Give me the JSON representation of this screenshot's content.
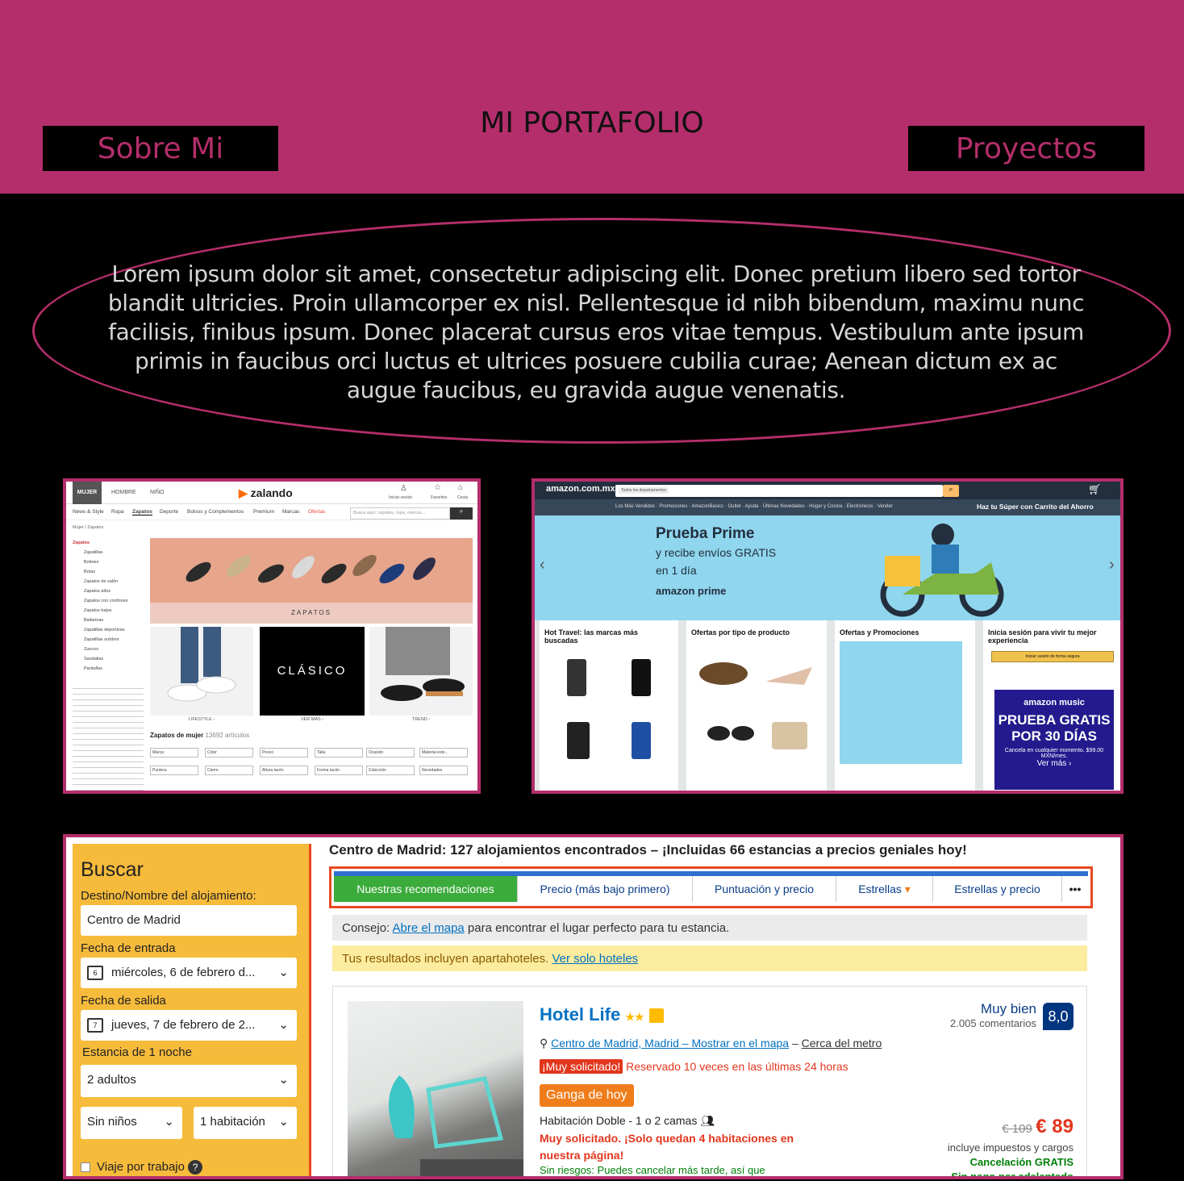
{
  "header": {
    "title": "MI PORTAFOLIO",
    "nav_left": "Sobre Mi",
    "nav_right": "Proyectos"
  },
  "intro": "Lorem ipsum dolor sit amet, consectetur adipiscing elit. Donec pretium libero sed tortor blandit ultricies. Proin ullamcorper ex nisl. Pellentesque id nibh bibendum, maximu nunc facilisis, finibus ipsum. Donec placerat cursus eros vitae tempus. Vestibulum ante ipsum primis in faucibus orci luctus et ultrices posuere cubilia curae; Aenean dictum ex ac augue faucibus, eu gravida augue venenatis.",
  "colors": {
    "accent": "#b42e6b",
    "background": "#000000",
    "booking_yellow": "#f7bb3b",
    "booking_orange": "#e8491f"
  },
  "zalando": {
    "tabs": [
      "MUJER",
      "HOMBRE",
      "NIÑO"
    ],
    "logo": "zalando",
    "account": [
      "Iniciar sesión",
      "Favoritos",
      "Cesta"
    ],
    "cats": [
      "News & Style",
      "Ropa",
      "Zapatos",
      "Deporte",
      "Bolsos y Complementos",
      "Premium",
      "Marcas",
      "Ofertas"
    ],
    "search": "Busca aquí: zapatos, ropa, marcas...",
    "crumb": "Mujer / Zapatos",
    "side": [
      "Zapatos",
      "Zapatillas",
      "Botines",
      "Botas",
      "Zapatos de salón",
      "Zapatos altos",
      "Zapatos con cordones",
      "Zapatos bajos",
      "Bailarinas",
      "Zapatillas deportivas",
      "Zapatillas outdoor",
      "Zuecos",
      "Sandalias",
      "Pantuflas"
    ],
    "banner": "ZAPATOS",
    "clasico": "CLÁSICO",
    "tile_labels": [
      "LIFESTYLE ›",
      "VER MÁS ›",
      "TREND ›"
    ],
    "heading": "Zapatos de mujer",
    "count": "13692 artículos",
    "filters1": [
      "Marca",
      "Color",
      "Precio",
      "Talla",
      "Ocasión",
      "Material exte..."
    ],
    "filters2": [
      "Puntera",
      "Cierre",
      "Altura tacón",
      "Forma tacón",
      "Colección",
      "Novedades"
    ]
  },
  "amazon": {
    "logo": "amazon.com.mx",
    "dept": "Todos los departamentos",
    "promo": "Haz tu Súper con Carrito del Ahorro",
    "nav": [
      "Los Más Vendidos",
      "Promociones",
      "AmazonBasics",
      "Outlet",
      "Ayuda",
      "Últimas Novedades",
      "Hogar y Cocina",
      "Electrónicos",
      "Vender"
    ],
    "hero": [
      "Prueba Prime",
      "y recibe envíos GRATIS",
      "en 1 día",
      "amazon prime"
    ],
    "cards": [
      "Hot Travel: las marcas más buscadas",
      "Ofertas por tipo de producto",
      "Ofertas y Promociones",
      "Inicia sesión para vivir tu mejor experiencia"
    ],
    "music": [
      "amazon music",
      "PRUEBA GRATIS",
      "POR 30 DÍAS",
      "Cancela en cualquier momento. $99.00 MXN/mes.",
      "Ver más ›"
    ],
    "signin": "Iniciar sesión de forma segura"
  },
  "booking": {
    "search_title": "Buscar",
    "dest_label": "Destino/Nombre del alojamiento:",
    "dest_value": "Centro de Madrid",
    "checkin_label": "Fecha de entrada",
    "checkin_day": "6",
    "checkin_value": "miércoles, 6 de febrero d...",
    "checkout_label": "Fecha de salida",
    "checkout_day": "7",
    "checkout_value": "jueves, 7 de febrero de 2...",
    "stay_label": "Estancia de 1 noche",
    "adults": "2 adultos",
    "children": "Sin niños",
    "rooms": "1 habitación",
    "business": "Viaje por trabajo",
    "results_title": "Centro de Madrid: 127 alojamientos encontrados – ¡Incluidas 66 estancias a precios geniales hoy!",
    "sort": [
      "Nuestras recomendaciones",
      "Precio (más bajo primero)",
      "Puntuación y precio",
      "Estrellas",
      "Estrellas y precio",
      "•••"
    ],
    "tip_prefix": "Consejo: ",
    "tip_link": "Abre el mapa",
    "tip_suffix": " para encontrar el lugar perfecto para tu estancia.",
    "apart_text": "Tus resultados incluyen apartahoteles. ",
    "apart_link": "Ver solo hoteles",
    "hotel_name": "Hotel Life",
    "stars": "★★",
    "location_link": "Centro de Madrid, Madrid – Mostrar en el mapa",
    "near": "Cerca del metro",
    "demand_badge": "¡Muy solicitado!",
    "booked": "Reservado 10 veces en las últimas 24 horas",
    "deal": "Ganga de hoy",
    "room": "Habitación Doble - 1 o 2 camas",
    "urgent": "Muy solicitado. ¡Solo quedan 4 habitaciones en nuestra página!",
    "norisk": "Sin riesgos: Puedes cancelar más tarde, así que",
    "rating_word": "Muy bien",
    "reviews": "2.005 comentarios",
    "score": "8,0",
    "old_price": "€ 109",
    "price": "€ 89",
    "taxes": "incluye impuestos y cargos",
    "free_cancel": "Cancelación GRATIS",
    "no_prepay": "Sin pago por adelantado"
  }
}
